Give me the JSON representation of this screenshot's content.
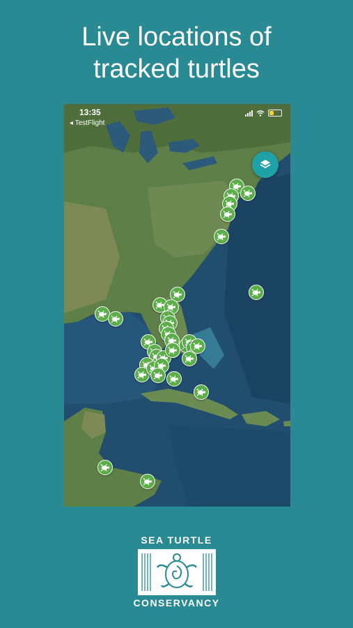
{
  "headline": {
    "line1": "Live locations of",
    "line2": "tracked turtles"
  },
  "status_bar": {
    "time": "13:35",
    "back_label": "◂ TestFlight",
    "battery_level": 0.35
  },
  "map": {
    "layers_button_icon": "layers-icon",
    "marker_icon": "turtle-icon",
    "marker_color": "#5cae4b",
    "marker_count": 36
  },
  "logo": {
    "top_text": "SEA TURTLE",
    "bottom_text": "CONSERVANCY"
  },
  "colors": {
    "background": "#2a8a93",
    "ocean": "#1f4a6b",
    "land": "#5f7f4a",
    "layers_button": "#1fa1a8"
  }
}
